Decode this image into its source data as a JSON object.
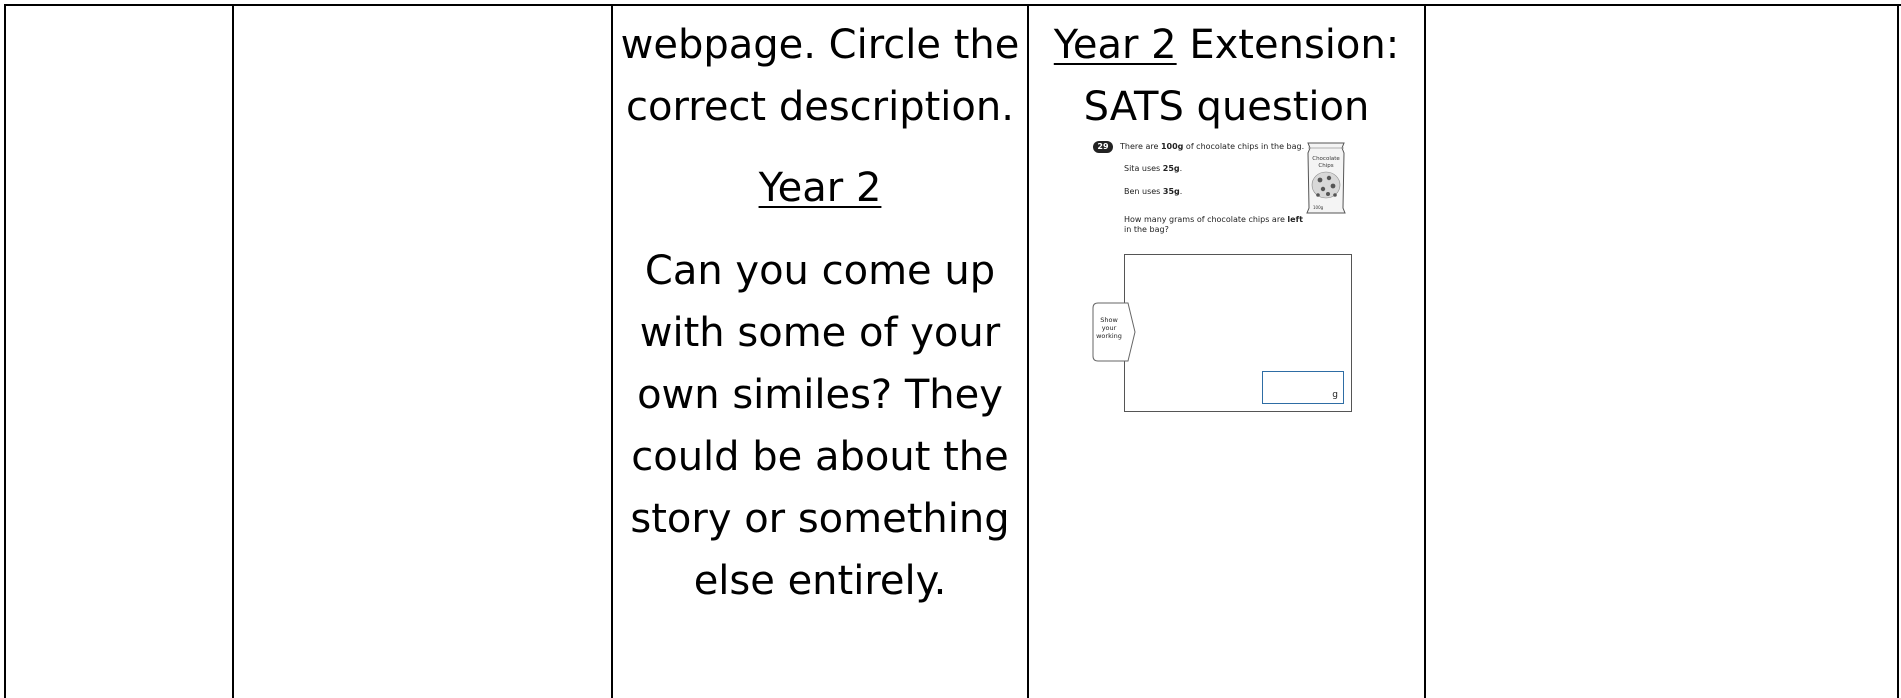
{
  "columns": {
    "col3": {
      "line1": "webpage. Circle the",
      "line2": "correct description.",
      "heading": "Year 2",
      "body_lines": [
        "Can you come up",
        "with some of your",
        "own similes? They",
        "could be about the",
        "story or something",
        "else entirely."
      ]
    },
    "col4": {
      "heading_underlined": "Year 2",
      "heading_rest": " Extension:",
      "heading_line2": "SATS question",
      "sats": {
        "question_number": "29",
        "line1_pre": "There are ",
        "line1_bold": "100g",
        "line1_post": " of chocolate chips in the bag.",
        "line2_pre": "Sita uses ",
        "line2_bold": "25g",
        "line2_post": ".",
        "line3_pre": "Ben uses ",
        "line3_bold": "35g",
        "line3_post": ".",
        "question_pre": "How many grams of chocolate chips are ",
        "question_bold": "left",
        "question_post": "in the bag?",
        "bag_label_1": "Chocolate",
        "bag_label_2": "Chips",
        "bag_weight": "100g",
        "show_working_1": "Show",
        "show_working_2": "your",
        "show_working_3": "working",
        "answer_unit": "g"
      }
    }
  }
}
